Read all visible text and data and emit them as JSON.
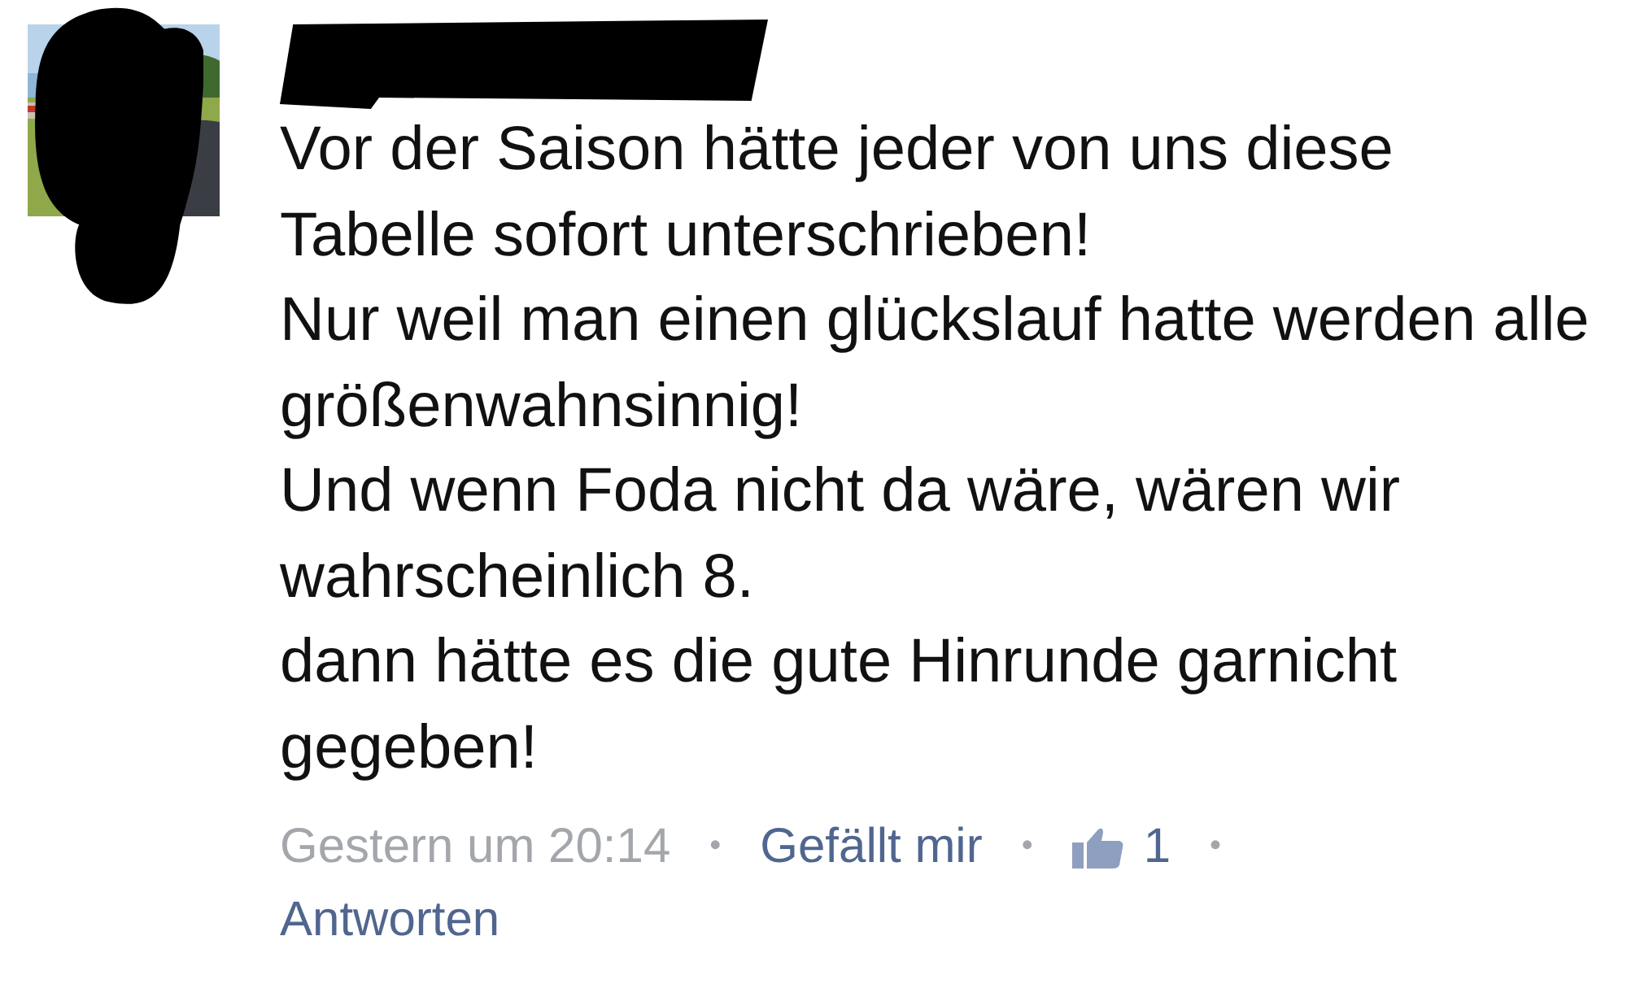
{
  "comment": {
    "separator": "•",
    "paragraphs": [
      "Vor der Saison hätte jeder von uns diese Tabelle sofort unterschrieben!",
      "Nur weil man einen glückslauf hatte werden alle größenwahnsinnig!",
      "Und wenn Foda nicht da wäre, wären wir wahrscheinlich 8.",
      "dann hätte es die gute Hinrunde garnicht gegeben!"
    ],
    "timestamp": "Gestern um 20:14",
    "like_link": "Gefällt mir",
    "like_count": "1",
    "reply_link": "Antworten"
  }
}
